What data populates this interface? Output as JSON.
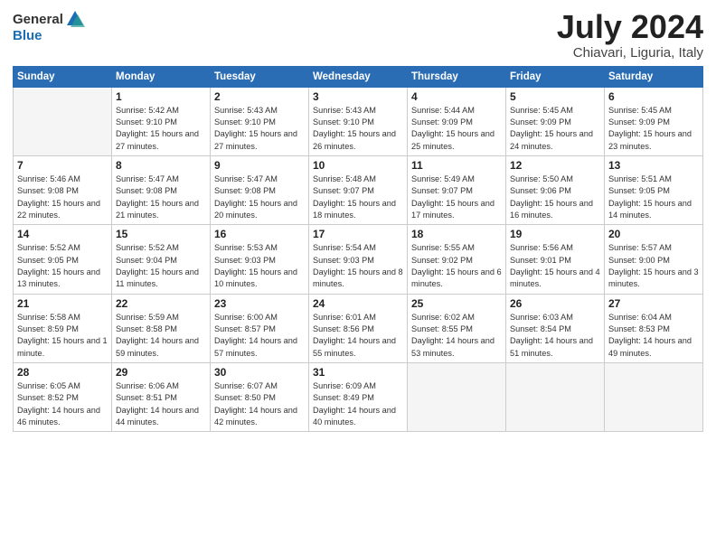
{
  "logo": {
    "general": "General",
    "blue": "Blue"
  },
  "title": "July 2024",
  "location": "Chiavari, Liguria, Italy",
  "weekdays": [
    "Sunday",
    "Monday",
    "Tuesday",
    "Wednesday",
    "Thursday",
    "Friday",
    "Saturday"
  ],
  "weeks": [
    [
      {
        "day": "",
        "empty": true
      },
      {
        "day": "1",
        "sunrise": "5:42 AM",
        "sunset": "9:10 PM",
        "daylight": "15 hours and 27 minutes."
      },
      {
        "day": "2",
        "sunrise": "5:43 AM",
        "sunset": "9:10 PM",
        "daylight": "15 hours and 27 minutes."
      },
      {
        "day": "3",
        "sunrise": "5:43 AM",
        "sunset": "9:10 PM",
        "daylight": "15 hours and 26 minutes."
      },
      {
        "day": "4",
        "sunrise": "5:44 AM",
        "sunset": "9:09 PM",
        "daylight": "15 hours and 25 minutes."
      },
      {
        "day": "5",
        "sunrise": "5:45 AM",
        "sunset": "9:09 PM",
        "daylight": "15 hours and 24 minutes."
      },
      {
        "day": "6",
        "sunrise": "5:45 AM",
        "sunset": "9:09 PM",
        "daylight": "15 hours and 23 minutes."
      }
    ],
    [
      {
        "day": "7",
        "sunrise": "5:46 AM",
        "sunset": "9:08 PM",
        "daylight": "15 hours and 22 minutes."
      },
      {
        "day": "8",
        "sunrise": "5:47 AM",
        "sunset": "9:08 PM",
        "daylight": "15 hours and 21 minutes."
      },
      {
        "day": "9",
        "sunrise": "5:47 AM",
        "sunset": "9:08 PM",
        "daylight": "15 hours and 20 minutes."
      },
      {
        "day": "10",
        "sunrise": "5:48 AM",
        "sunset": "9:07 PM",
        "daylight": "15 hours and 18 minutes."
      },
      {
        "day": "11",
        "sunrise": "5:49 AM",
        "sunset": "9:07 PM",
        "daylight": "15 hours and 17 minutes."
      },
      {
        "day": "12",
        "sunrise": "5:50 AM",
        "sunset": "9:06 PM",
        "daylight": "15 hours and 16 minutes."
      },
      {
        "day": "13",
        "sunrise": "5:51 AM",
        "sunset": "9:05 PM",
        "daylight": "15 hours and 14 minutes."
      }
    ],
    [
      {
        "day": "14",
        "sunrise": "5:52 AM",
        "sunset": "9:05 PM",
        "daylight": "15 hours and 13 minutes."
      },
      {
        "day": "15",
        "sunrise": "5:52 AM",
        "sunset": "9:04 PM",
        "daylight": "15 hours and 11 minutes."
      },
      {
        "day": "16",
        "sunrise": "5:53 AM",
        "sunset": "9:03 PM",
        "daylight": "15 hours and 10 minutes."
      },
      {
        "day": "17",
        "sunrise": "5:54 AM",
        "sunset": "9:03 PM",
        "daylight": "15 hours and 8 minutes."
      },
      {
        "day": "18",
        "sunrise": "5:55 AM",
        "sunset": "9:02 PM",
        "daylight": "15 hours and 6 minutes."
      },
      {
        "day": "19",
        "sunrise": "5:56 AM",
        "sunset": "9:01 PM",
        "daylight": "15 hours and 4 minutes."
      },
      {
        "day": "20",
        "sunrise": "5:57 AM",
        "sunset": "9:00 PM",
        "daylight": "15 hours and 3 minutes."
      }
    ],
    [
      {
        "day": "21",
        "sunrise": "5:58 AM",
        "sunset": "8:59 PM",
        "daylight": "15 hours and 1 minute."
      },
      {
        "day": "22",
        "sunrise": "5:59 AM",
        "sunset": "8:58 PM",
        "daylight": "14 hours and 59 minutes."
      },
      {
        "day": "23",
        "sunrise": "6:00 AM",
        "sunset": "8:57 PM",
        "daylight": "14 hours and 57 minutes."
      },
      {
        "day": "24",
        "sunrise": "6:01 AM",
        "sunset": "8:56 PM",
        "daylight": "14 hours and 55 minutes."
      },
      {
        "day": "25",
        "sunrise": "6:02 AM",
        "sunset": "8:55 PM",
        "daylight": "14 hours and 53 minutes."
      },
      {
        "day": "26",
        "sunrise": "6:03 AM",
        "sunset": "8:54 PM",
        "daylight": "14 hours and 51 minutes."
      },
      {
        "day": "27",
        "sunrise": "6:04 AM",
        "sunset": "8:53 PM",
        "daylight": "14 hours and 49 minutes."
      }
    ],
    [
      {
        "day": "28",
        "sunrise": "6:05 AM",
        "sunset": "8:52 PM",
        "daylight": "14 hours and 46 minutes."
      },
      {
        "day": "29",
        "sunrise": "6:06 AM",
        "sunset": "8:51 PM",
        "daylight": "14 hours and 44 minutes."
      },
      {
        "day": "30",
        "sunrise": "6:07 AM",
        "sunset": "8:50 PM",
        "daylight": "14 hours and 42 minutes."
      },
      {
        "day": "31",
        "sunrise": "6:09 AM",
        "sunset": "8:49 PM",
        "daylight": "14 hours and 40 minutes."
      },
      {
        "day": "",
        "empty": true
      },
      {
        "day": "",
        "empty": true
      },
      {
        "day": "",
        "empty": true
      }
    ]
  ]
}
